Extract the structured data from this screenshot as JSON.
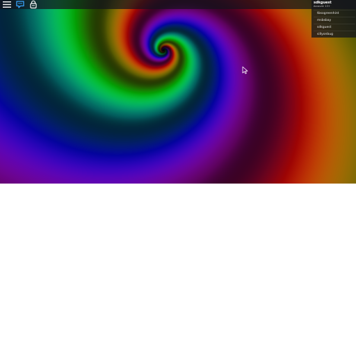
{
  "topbar": {
    "menu_icon": "hamburger-menu-icon",
    "chat_icon": "chat-bubble-icon",
    "backpack_icon": "backpack-icon",
    "chat_color": "#3aa6ff",
    "icon_color": "#ffffff"
  },
  "players": {
    "local_user": {
      "name": "sdkguest",
      "subtitle": "Account: 13+"
    },
    "list": [
      {
        "name": "tbsogreenhint"
      },
      {
        "name": "msbsbay"
      },
      {
        "name": "sdkguest"
      },
      {
        "name": "sillyonbug"
      }
    ]
  },
  "scene": {
    "background": "rainbow-spiral",
    "lower_area_color": "#ffffff"
  }
}
